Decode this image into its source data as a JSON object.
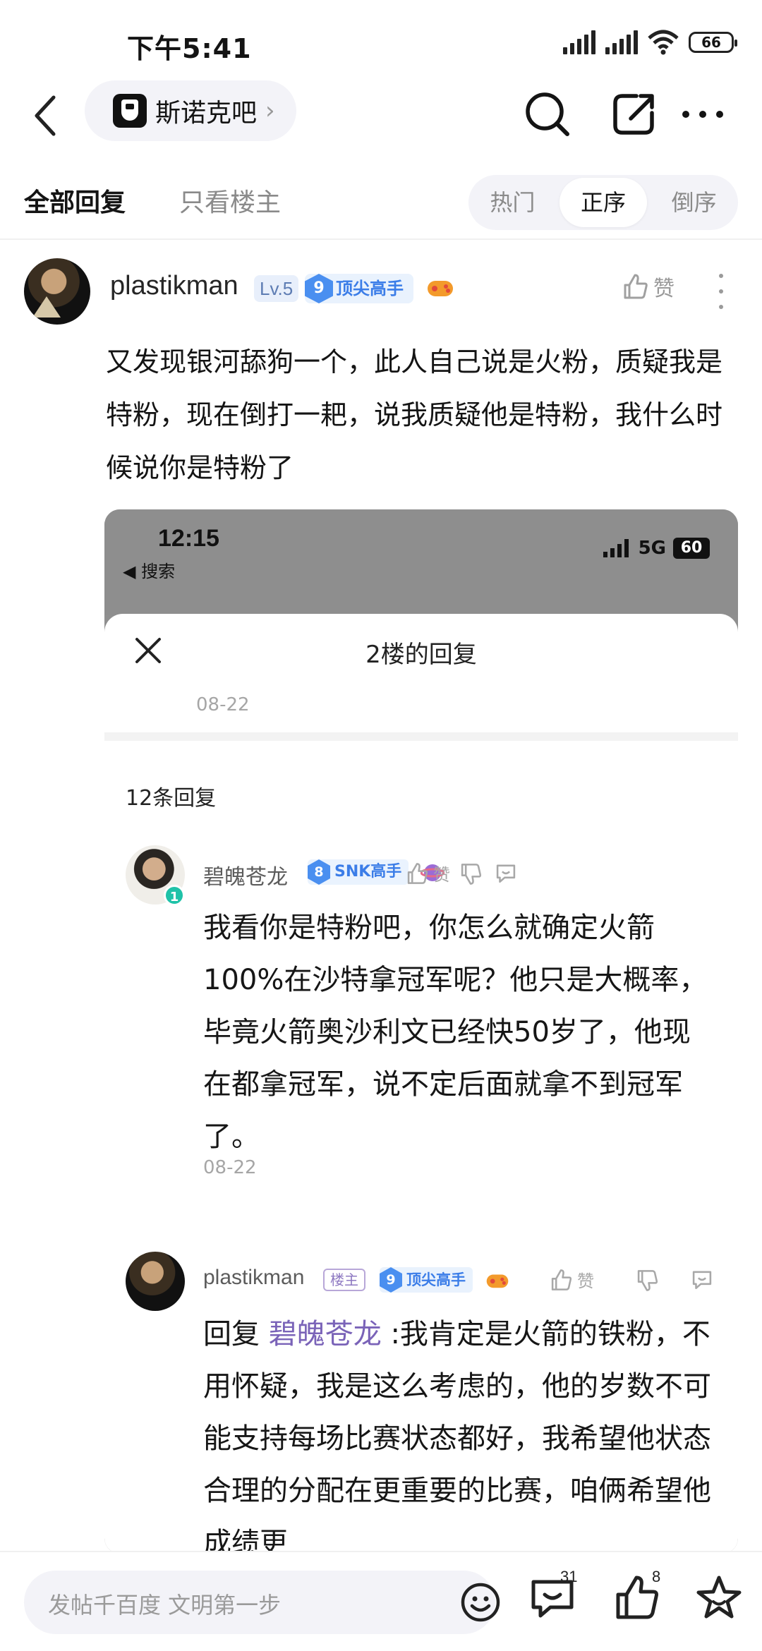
{
  "status_bar": {
    "time": "下午5:41",
    "battery": "66"
  },
  "nav": {
    "forum_name": "斯诺克吧"
  },
  "tabs": {
    "all": "全部回复",
    "op_only": "只看楼主",
    "sort": [
      "热门",
      "正序",
      "倒序"
    ],
    "active_sort": "正序"
  },
  "post": {
    "username": "plastikman",
    "level": "Lv.5",
    "rank_num": "9",
    "rank_title": "顶尖高手",
    "like_label": "赞",
    "text": "又发现银河舔狗一个，此人自己说是火粉，质疑我是特粉，现在倒打一耙，说我质疑他是特粉，我什么时候说你是特粉了"
  },
  "screenshot": {
    "time": "12:15",
    "back_label": "◀ 搜索",
    "network": "5G",
    "battery": "60",
    "sheet_title": "2楼的回复",
    "top_date": "08-22",
    "reply_count": "12条回复",
    "replies": [
      {
        "name": "碧魄苍龙",
        "avatar_level": "1",
        "rank_num": "8",
        "rank_title": "SNK高手",
        "like_label": "赞",
        "text": "我看你是特粉吧，你怎么就确定火箭100%在沙特拿冠军呢？他只是大概率，毕竟火箭奥沙利文已经快50岁了，他现在都拿冠军，说不定后面就拿不到冠军了。",
        "date": "08-22"
      },
      {
        "name": "plastikman",
        "op_tag": "楼主",
        "rank_num": "9",
        "rank_title": "顶尖高手",
        "like_label": "赞",
        "reply_prefix": "回复",
        "mention": "碧魄苍龙",
        "text": ":我肯定是火箭的铁粉，不用怀疑，我是这么考虑的，他的岁数不可能支持每场比赛状态都好，我希望他状态合理的分配在更重要的比赛，咱俩希望他成绩更"
      }
    ]
  },
  "bottom_bar": {
    "compose_placeholder": "发帖千百度 文明第一步",
    "comment_count": "31",
    "like_count": "8"
  },
  "colors": {
    "accent_blue": "#3b7de8",
    "mention_purple": "#7a63b8",
    "pill_bg": "#f3f3f8"
  }
}
